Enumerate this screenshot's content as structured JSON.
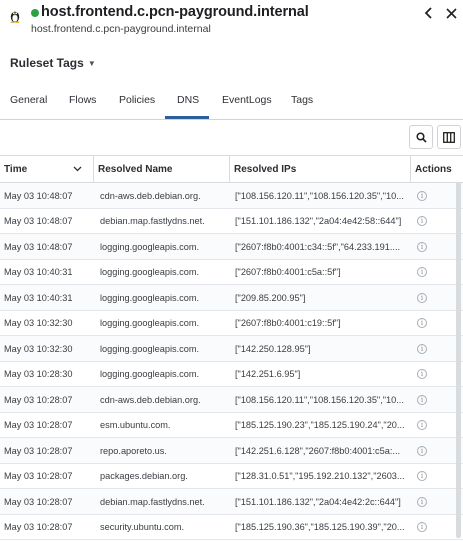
{
  "header": {
    "os_icon": "linux-penguin-icon",
    "status_color": "#2ea043",
    "title": "host.frontend.c.pcn-payground.internal",
    "subtitle": "host.frontend.c.pcn-payground.internal",
    "back_icon": "chevron-left-icon",
    "close_icon": "close-icon"
  },
  "ruleset": {
    "label": "Ruleset Tags",
    "icon": "chevron-down-icon"
  },
  "tabs": [
    {
      "label": "General"
    },
    {
      "label": "Flows"
    },
    {
      "label": "Policies"
    },
    {
      "label": "DNS",
      "active": true
    },
    {
      "label": "EventLogs"
    },
    {
      "label": "Tags"
    }
  ],
  "toolbar": {
    "search_icon": "search-icon",
    "columns_icon": "columns-icon"
  },
  "table": {
    "columns": [
      "Time",
      "Resolved Name",
      "Resolved IPs",
      "Actions"
    ],
    "rows": [
      {
        "time": "May 03 10:48:07",
        "name": "cdn-aws.deb.debian.org.",
        "ips": "[\"108.156.120.11\",\"108.156.120.35\",\"10..."
      },
      {
        "time": "May 03 10:48:07",
        "name": "debian.map.fastlydns.net.",
        "ips": "[\"151.101.186.132\",\"2a04:4e42:58::644\"]"
      },
      {
        "time": "May 03 10:48:07",
        "name": "logging.googleapis.com.",
        "ips": "[\"2607:f8b0:4001:c34::5f\",\"64.233.191...."
      },
      {
        "time": "May 03 10:40:31",
        "name": "logging.googleapis.com.",
        "ips": "[\"2607:f8b0:4001:c5a::5f\"]"
      },
      {
        "time": "May 03 10:40:31",
        "name": "logging.googleapis.com.",
        "ips": "[\"209.85.200.95\"]"
      },
      {
        "time": "May 03 10:32:30",
        "name": "logging.googleapis.com.",
        "ips": "[\"2607:f8b0:4001:c19::5f\"]"
      },
      {
        "time": "May 03 10:32:30",
        "name": "logging.googleapis.com.",
        "ips": "[\"142.250.128.95\"]"
      },
      {
        "time": "May 03 10:28:30",
        "name": "logging.googleapis.com.",
        "ips": "[\"142.251.6.95\"]"
      },
      {
        "time": "May 03 10:28:07",
        "name": "cdn-aws.deb.debian.org.",
        "ips": "[\"108.156.120.11\",\"108.156.120.35\",\"10..."
      },
      {
        "time": "May 03 10:28:07",
        "name": "esm.ubuntu.com.",
        "ips": "[\"185.125.190.23\",\"185.125.190.24\",\"20..."
      },
      {
        "time": "May 03 10:28:07",
        "name": "repo.aporeto.us.",
        "ips": "[\"142.251.6.128\",\"2607:f8b0:4001:c5a:..."
      },
      {
        "time": "May 03 10:28:07",
        "name": "packages.debian.org.",
        "ips": "[\"128.31.0.51\",\"195.192.210.132\",\"2603..."
      },
      {
        "time": "May 03 10:28:07",
        "name": "debian.map.fastlydns.net.",
        "ips": "[\"151.101.186.132\",\"2a04:4e42:2c::644\"]"
      },
      {
        "time": "May 03 10:28:07",
        "name": "security.ubuntu.com.",
        "ips": "[\"185.125.190.36\",\"185.125.190.39\",\"20..."
      }
    ],
    "action_icon": "info-icon"
  }
}
